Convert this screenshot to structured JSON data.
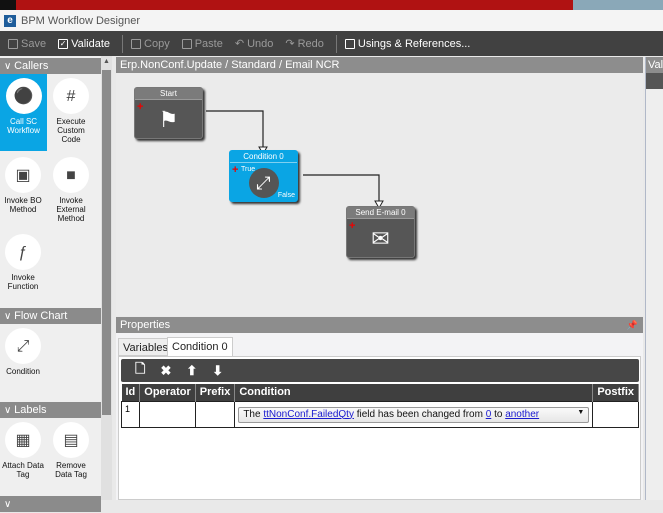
{
  "window": {
    "title": "BPM Workflow Designer",
    "logo": "e"
  },
  "toolbar": {
    "save": "Save",
    "validate": "Validate",
    "copy": "Copy",
    "paste": "Paste",
    "undo": "Undo",
    "redo": "Redo",
    "usings": "Usings & References..."
  },
  "palette": {
    "sections": [
      {
        "label": "Callers"
      },
      {
        "label": "Flow Chart"
      },
      {
        "label": "Labels"
      }
    ],
    "callers": [
      {
        "label": "Call SC Workflow",
        "icon": "workflow-icon",
        "selected": true
      },
      {
        "label": "Execute Custom Code",
        "icon": "hash-document-icon"
      },
      {
        "label": "Invoke BO Method",
        "icon": "bo-method-icon"
      },
      {
        "label": "Invoke External Method",
        "icon": "external-method-icon"
      },
      {
        "label": "Invoke Function",
        "icon": "function-icon"
      }
    ],
    "flowchart": [
      {
        "label": "Condition",
        "icon": "condition-icon"
      }
    ],
    "labels": [
      {
        "label": "Attach Data Tag",
        "icon": "attach-tag-icon"
      },
      {
        "label": "Remove Data Tag",
        "icon": "remove-tag-icon"
      }
    ]
  },
  "canvas": {
    "breadcrumb": "Erp.NonConf.Update / Standard / Email NCR",
    "nodes": {
      "start": "Start",
      "condition": "Condition 0",
      "condition_true": "True",
      "condition_false": "False",
      "email": "Send E-mail 0"
    }
  },
  "properties": {
    "title": "Properties",
    "tabs": [
      "Variables",
      "Condition 0"
    ],
    "active_tab": "Condition 0",
    "columns": [
      "Id",
      "Operator",
      "Prefix",
      "Condition",
      "Postfix"
    ],
    "rows": [
      {
        "id": "1",
        "operator": "",
        "prefix": "",
        "condition": {
          "t1": "The",
          "field": "ttNonConf.FailedQty",
          "t2": "field has been changed from",
          "from": "0",
          "t3": "to",
          "to": "another"
        },
        "postfix": ""
      }
    ]
  },
  "right_panel": {
    "title": "Val"
  },
  "colors": {
    "accent": "#0aa5e4",
    "toolbar": "#414141",
    "header": "#8d8d8d"
  }
}
